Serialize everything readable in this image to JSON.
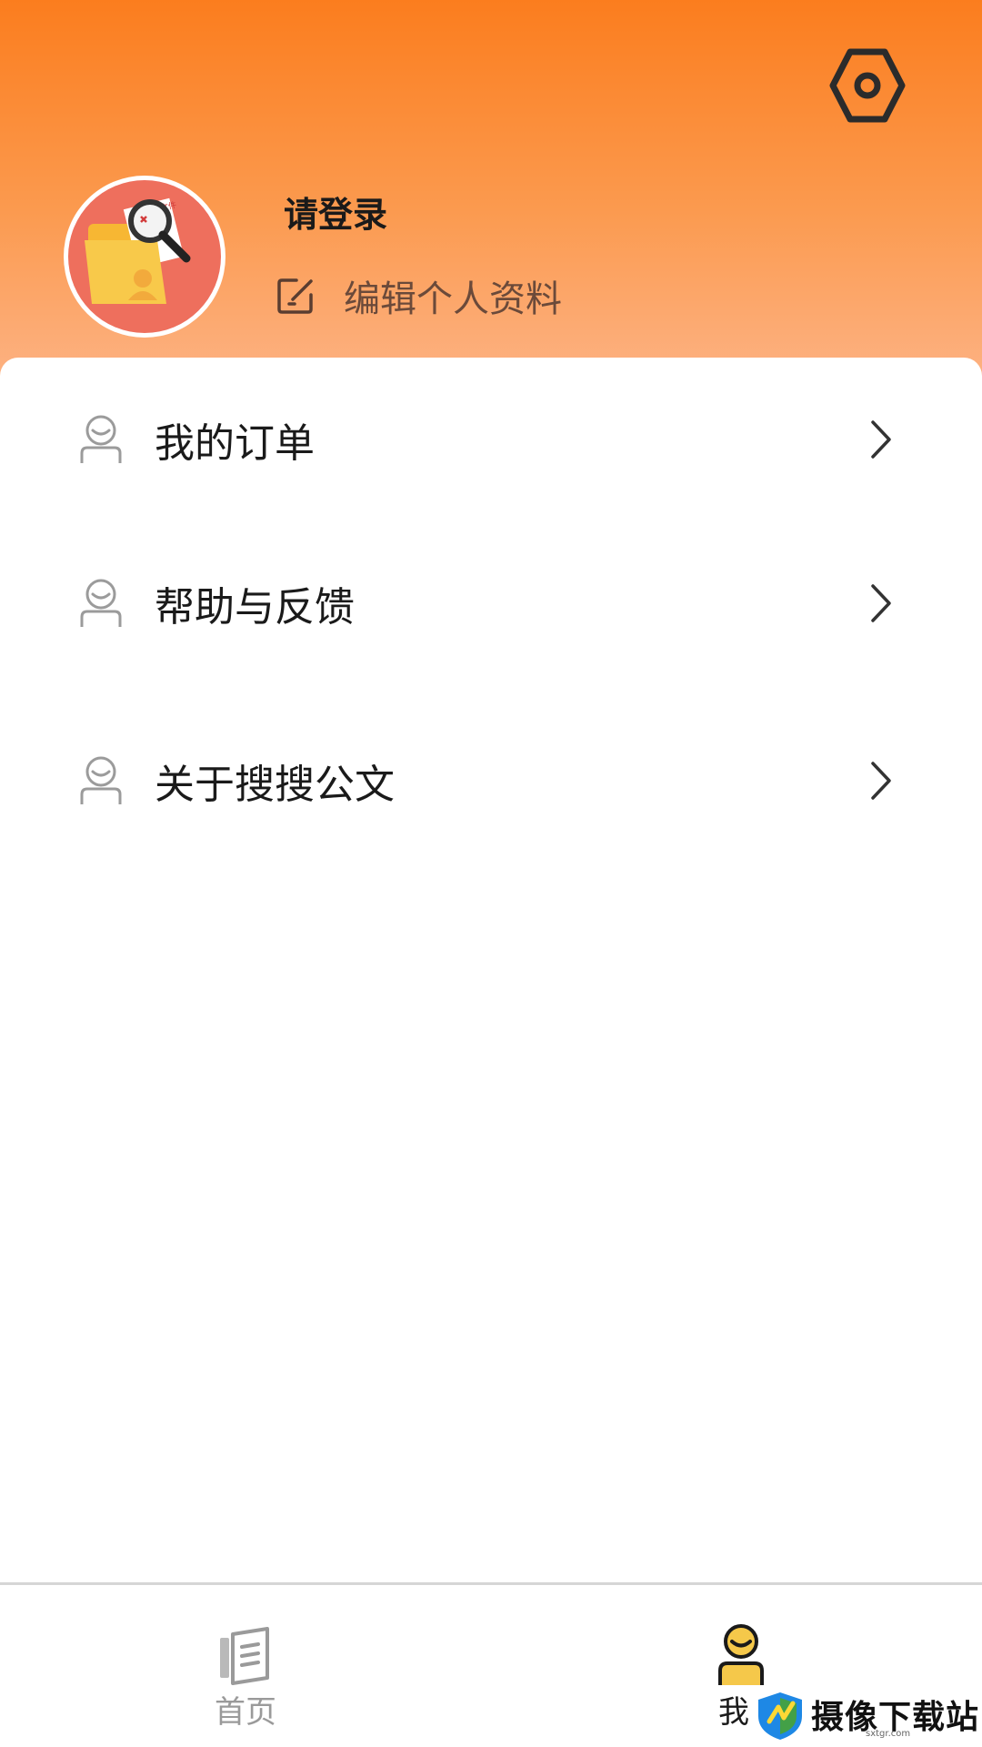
{
  "header": {
    "gradient_colors": [
      "#fb7d1e",
      "#fdb283"
    ],
    "settings_icon": "settings-hexagon-icon",
    "avatar_icon": "folder-search-document-icon",
    "login_label": "请登录",
    "edit_icon": "edit-icon",
    "edit_label": "编辑个人资料"
  },
  "menu": {
    "items": [
      {
        "icon": "user-icon",
        "label": "我的订单"
      },
      {
        "icon": "user-icon",
        "label": "帮助与反馈"
      },
      {
        "icon": "user-icon",
        "label": "关于搜搜公文"
      }
    ]
  },
  "tabbar": {
    "tabs": [
      {
        "icon": "book-icon",
        "label": "首页",
        "active": false
      },
      {
        "icon": "user-active-icon",
        "label": "我",
        "active": true
      }
    ],
    "active_color": "#f5b72c"
  },
  "watermark": {
    "text": "摄像下载站",
    "url": "sxtgr.com"
  }
}
